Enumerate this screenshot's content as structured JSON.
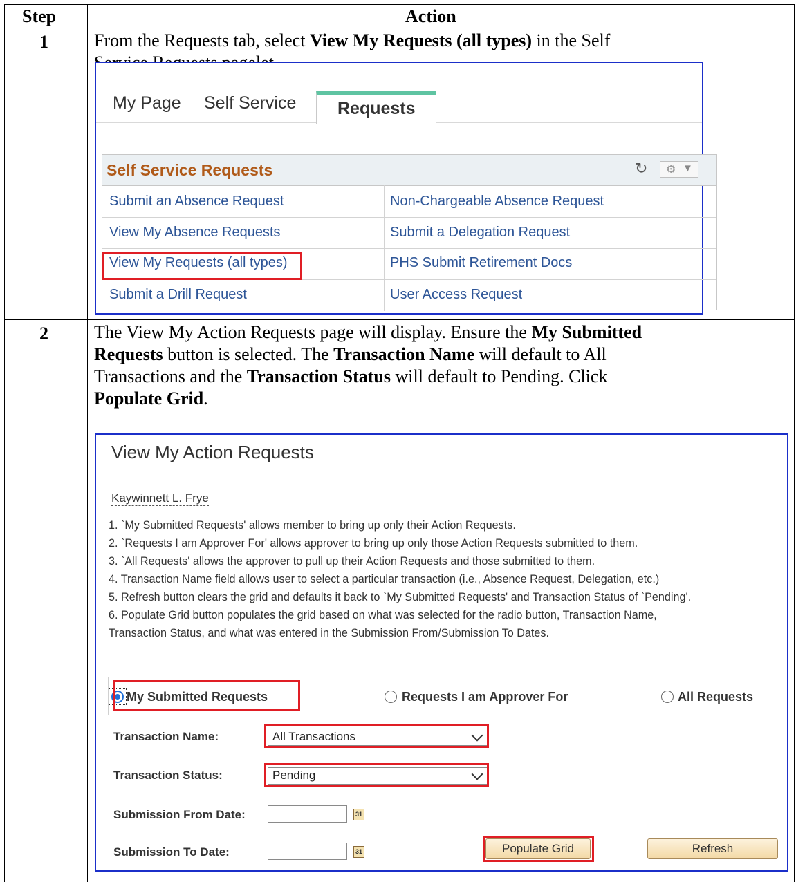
{
  "table": {
    "header_step": "Step",
    "header_action": "Action"
  },
  "step1": {
    "number": "1",
    "text_parts": [
      "From the Requests tab, select ",
      "View My Requests (all types)",
      " in the Self",
      "Service Requests pagelet."
    ]
  },
  "screen1": {
    "tabs": [
      "My Page",
      "Self Service",
      "Requests"
    ],
    "pagelet_title": "Self Service Requests",
    "refresh_icon": "refresh-icon",
    "gear_icon": "gear-icon",
    "links_left": [
      "Submit an Absence Request",
      "View My Absence Requests",
      "View My Requests (all types)",
      "Submit a Drill Request"
    ],
    "links_right": [
      "Non-Chargeable Absence Request",
      "Submit a Delegation Request",
      "PHS Submit Retirement Docs",
      "User Access Request"
    ],
    "link_color": "#2d5597",
    "title_color": "#b05a19",
    "highlight_color": "#e01e25"
  },
  "step2": {
    "number": "2",
    "line1": [
      "The View My Action Requests page will display.  Ensure the ",
      "My Submitted"
    ],
    "line2": [
      "Requests",
      " button is selected.  The ",
      "Transaction Name",
      " will default to All"
    ],
    "line3": [
      "Transactions and the ",
      "Transaction Status",
      " will default to Pending.  Click"
    ],
    "line4": [
      "Populate Grid",
      "."
    ]
  },
  "screen2": {
    "title": "View My Action Requests",
    "member_name": "Kaywinnett L. Frye",
    "instructions": [
      "1. `My Submitted Requests' allows member to bring up only their Action Requests.",
      "2. `Requests I am Approver For' allows approver to bring up only those Action Requests submitted to them.",
      "3. `All Requests' allows the approver to pull up their Action Requests and those submitted to them.",
      "4. Transaction Name field allows user to select a particular transaction (i.e., Absence Request, Delegation, etc.)",
      "5. Refresh button clears the grid and defaults it back to `My Submitted Requests' and Transaction Status of `Pending'.",
      "6. Populate Grid button populates the grid based on what was selected for the radio button, Transaction Name,",
      "Transaction Status, and what was entered in the Submission From/Submission To Dates."
    ],
    "radios": {
      "my_submitted": "My Submitted Requests",
      "approver_for": "Requests I am Approver For",
      "all": "All Requests",
      "selected": "My Submitted Requests"
    },
    "transaction_name_label": "Transaction Name:",
    "transaction_name_value": "All Transactions",
    "transaction_status_label": "Transaction Status:",
    "transaction_status_value": "Pending",
    "from_date_label": "Submission From Date:",
    "from_date_value": "",
    "to_date_label": "Submission To Date:",
    "to_date_value": "",
    "calendar_icon_text": "31",
    "populate_button": "Populate Grid",
    "refresh_button": "Refresh"
  }
}
